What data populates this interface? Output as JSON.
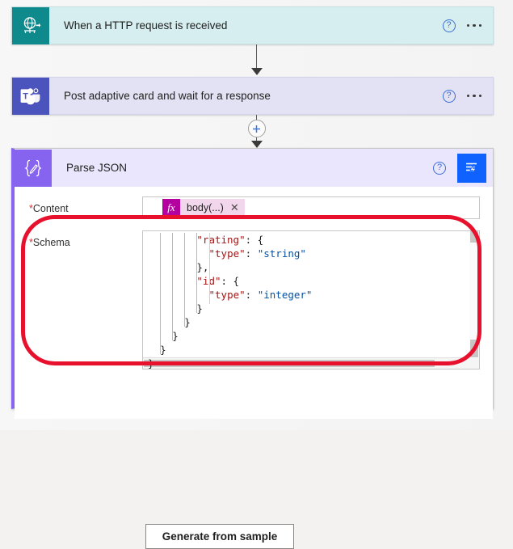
{
  "flow": {
    "steps": [
      {
        "id": "http-trigger",
        "title": "When a HTTP request is received",
        "icon": "globe-http-icon",
        "help_label": "?",
        "menu_label": "…"
      },
      {
        "id": "teams-post-adaptive-card",
        "title": "Post adaptive card and wait for a response",
        "icon": "teams-icon",
        "help_label": "?",
        "menu_label": "…"
      }
    ],
    "insert_button_label": "+"
  },
  "parse_json": {
    "title": "Parse JSON",
    "icon": "braces-pencil-icon",
    "help_label": "?",
    "flow_checker_label": "flow-checker",
    "fields": {
      "content": {
        "required_marker": "*",
        "label": "Content",
        "token": {
          "fx_label": "fx",
          "text": "body(...)",
          "close_label": "✕"
        }
      },
      "schema": {
        "required_marker": "*",
        "label": "Schema",
        "code_lines": [
          {
            "indent": 8,
            "parts": [
              {
                "cls": "k",
                "t": "\"rating\""
              },
              {
                "cls": "p",
                "t": ": {"
              }
            ]
          },
          {
            "indent": 10,
            "parts": [
              {
                "cls": "k",
                "t": "\"type\""
              },
              {
                "cls": "p",
                "t": ": "
              },
              {
                "cls": "s",
                "t": "\"string\""
              }
            ]
          },
          {
            "indent": 8,
            "parts": [
              {
                "cls": "p",
                "t": "},"
              }
            ]
          },
          {
            "indent": 8,
            "parts": [
              {
                "cls": "k",
                "t": "\"id\""
              },
              {
                "cls": "p",
                "t": ": {"
              }
            ]
          },
          {
            "indent": 10,
            "parts": [
              {
                "cls": "k",
                "t": "\"type\""
              },
              {
                "cls": "p",
                "t": ": "
              },
              {
                "cls": "s",
                "t": "\"integer\""
              }
            ]
          },
          {
            "indent": 8,
            "parts": [
              {
                "cls": "p",
                "t": "}"
              }
            ]
          },
          {
            "indent": 6,
            "parts": [
              {
                "cls": "p",
                "t": "}"
              }
            ]
          },
          {
            "indent": 4,
            "parts": [
              {
                "cls": "p",
                "t": "}"
              }
            ]
          },
          {
            "indent": 2,
            "parts": [
              {
                "cls": "p",
                "t": "}"
              }
            ]
          }
        ],
        "overflow_brace": "}"
      }
    },
    "generate_from_sample_label": "Generate from sample"
  },
  "annotation": {
    "shape": "rounded-rectangle-highlight",
    "color": "#e8112d"
  },
  "colors": {
    "http_icon": "#0f8a8c",
    "http_card": "#d6eef0",
    "teams_icon": "#4b53bc",
    "teams_card": "#e2e2f4",
    "parsejson_icon": "#8764f0",
    "parsejson_header": "#eae6fd",
    "flow_checker": "#0f62fe",
    "token_fx": "#b4009e",
    "token_chip": "#f2d7ec",
    "help_blue": "#3b6fd4",
    "json_key": "#a31515",
    "json_string": "#0451a5"
  }
}
